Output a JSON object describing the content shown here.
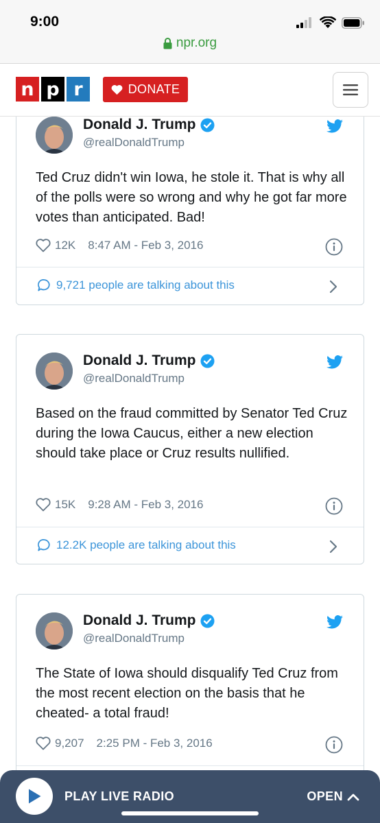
{
  "status_bar": {
    "time": "9:00",
    "url": "npr.org"
  },
  "header": {
    "logo_letters": [
      "n",
      "p",
      "r"
    ],
    "logo_colors": [
      "#d62021",
      "#000000",
      "#237bbd"
    ],
    "donate_label": "DONATE"
  },
  "tweets": [
    {
      "name": "Donald J. Trump",
      "handle": "@realDonaldTrump",
      "text": "Ted Cruz didn't win Iowa, he stole it. That is why all of the polls were so wrong and why he got far more votes than anticipated. Bad!",
      "likes": "12K",
      "timestamp": "8:47 AM - Feb 3, 2016",
      "talking": "9,721 people are talking about this"
    },
    {
      "name": "Donald J. Trump",
      "handle": "@realDonaldTrump",
      "text": "Based on the fraud committed by Senator Ted Cruz during the Iowa Caucus, either a new election should take place or Cruz results nullified.",
      "likes": "15K",
      "timestamp": "9:28 AM - Feb 3, 2016",
      "talking": "12.2K people are talking about this"
    },
    {
      "name": "Donald J. Trump",
      "handle": "@realDonaldTrump",
      "text": "The State of Iowa should disqualify Ted Cruz from the most recent election on the basis that he cheated- a total fraud!",
      "likes": "9,207",
      "timestamp": "2:25 PM - Feb 3, 2016",
      "talking": ""
    }
  ],
  "player": {
    "play_label": "PLAY LIVE RADIO",
    "open_label": "OPEN"
  },
  "colors": {
    "accent_blue": "#1da1f2",
    "link_blue": "#3b94d9",
    "player_bg": "#3d4f69",
    "donate_red": "#d62021"
  }
}
